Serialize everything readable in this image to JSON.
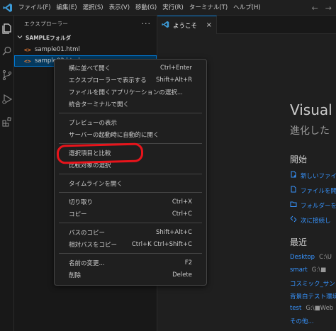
{
  "menubar": {
    "items": [
      "ファイル(F)",
      "編集(E)",
      "選択(S)",
      "表示(V)",
      "移動(G)",
      "実行(R)",
      "ターミナル(T)",
      "ヘルプ(H)"
    ]
  },
  "nav": {
    "back": "←",
    "forward": "→"
  },
  "sidebar": {
    "title": "エクスプローラー",
    "more": "···",
    "folder": "SAMPLEフォルダ",
    "files": [
      "sample01.html",
      "sample02.html"
    ]
  },
  "tabs": [
    {
      "label": "ようこそ",
      "close": "×"
    }
  ],
  "welcome": {
    "title": "Visual",
    "subtitle": "進化した",
    "start_title": "開始",
    "start_items": [
      "新しいファイ",
      "ファイルを開",
      "フォルダーを開",
      "次に接続し"
    ],
    "recent_title": "最近",
    "recent": [
      {
        "name": "Desktop",
        "path": "C:\\U"
      },
      {
        "name": "smart",
        "path": "G:\\■"
      },
      {
        "name": "コスミック_サンミ",
        "path": ""
      },
      {
        "name": "背景白テスト環境",
        "path": ""
      },
      {
        "name": "test",
        "path": "G:\\■Web"
      }
    ],
    "more": "その他..."
  },
  "context_menu": {
    "groups": [
      [
        {
          "label": "横に並べて開く",
          "shortcut": "Ctrl+Enter"
        },
        {
          "label": "エクスプローラーで表示する",
          "shortcut": "Shift+Alt+R"
        },
        {
          "label": "ファイルを開くアプリケーションの選択...",
          "shortcut": ""
        },
        {
          "label": "統合ターミナルで開く",
          "shortcut": ""
        }
      ],
      [
        {
          "label": "プレビューの表示",
          "shortcut": ""
        },
        {
          "label": "サーバーの起動時に自動的に開く",
          "shortcut": ""
        }
      ],
      [
        {
          "label": "選択項目と比較",
          "shortcut": ""
        },
        {
          "label": "比較対象の選択",
          "shortcut": ""
        }
      ],
      [
        {
          "label": "タイムラインを開く",
          "shortcut": ""
        }
      ],
      [
        {
          "label": "切り取り",
          "shortcut": "Ctrl+X"
        },
        {
          "label": "コピー",
          "shortcut": "Ctrl+C"
        }
      ],
      [
        {
          "label": "パスのコピー",
          "shortcut": "Shift+Alt+C"
        },
        {
          "label": "相対パスをコピー",
          "shortcut": "Ctrl+K Ctrl+Shift+C"
        }
      ],
      [
        {
          "label": "名前の変更...",
          "shortcut": "F2"
        },
        {
          "label": "削除",
          "shortcut": "Delete"
        }
      ]
    ]
  },
  "colors": {
    "accent": "#0078d4",
    "link": "#3794ff",
    "annotation": "#e8141b",
    "background": "#1f1f1f"
  }
}
